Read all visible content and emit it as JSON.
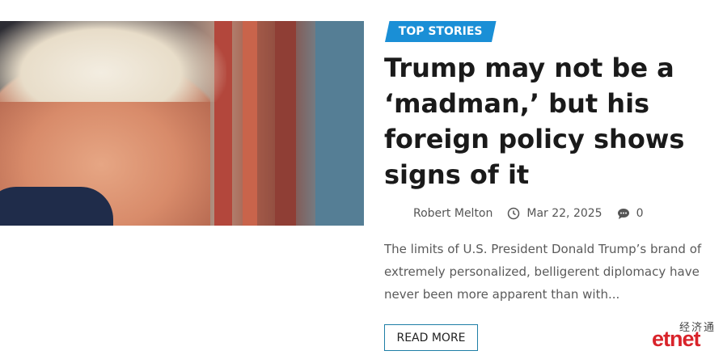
{
  "article": {
    "category": "TOP STORIES",
    "title": "Trump may not be a ‘madman,’ but his foreign policy shows signs of it",
    "author": "Robert Melton",
    "date": "Mar 22, 2025",
    "comments": "0",
    "excerpt": "The limits of U.S. President Donald Trump’s brand of extremely personalized, belligerent diplomacy have never been more apparent than with...",
    "read_more": "READ MORE"
  },
  "watermark": {
    "chinese": "经济通",
    "english": "etnet"
  },
  "colors": {
    "badge": "#1a8fd6",
    "button_border": "#1e7fa6",
    "logo_red": "#d9232a"
  },
  "icons": {
    "date": "clock-icon",
    "comments": "comment-bubble-icon"
  }
}
